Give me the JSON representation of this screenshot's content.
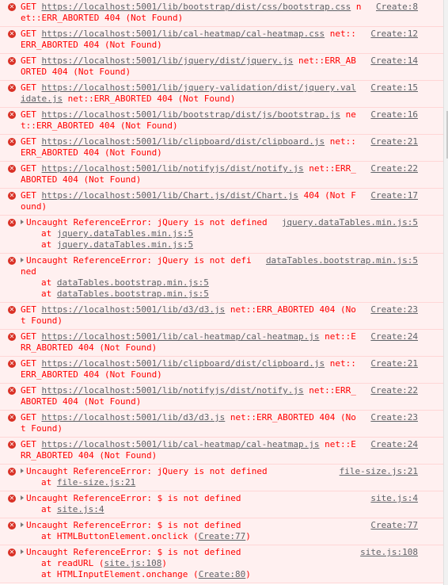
{
  "console": {
    "entries": [
      {
        "type": "get",
        "url": "https://localhost:5001/lib/bootstrap/dist/css/bootstrap.css",
        "suffix": "net::ERR_ABORTED 404 (Not Found)",
        "source": "Create:8"
      },
      {
        "type": "get",
        "url": "https://localhost:5001/lib/cal-heatmap/cal-heatmap.css",
        "suffix": "net::ERR_ABORTED 404 (Not Found)",
        "source": "Create:12"
      },
      {
        "type": "get",
        "url": "https://localhost:5001/lib/jquery/dist/jquery.js",
        "suffix": "net::ERR_ABORTED 404 (Not Found)",
        "source": "Create:14"
      },
      {
        "type": "get",
        "url": "https://localhost:5001/lib/jquery-validation/dist/jquery.validate.js",
        "suffix": "net::ERR_ABORTED 404 (Not Found)",
        "source": "Create:15"
      },
      {
        "type": "get",
        "url": "https://localhost:5001/lib/bootstrap/dist/js/bootstrap.js",
        "suffix": "net::ERR_ABORTED 404 (Not Found)",
        "source": "Create:16"
      },
      {
        "type": "get",
        "url": "https://localhost:5001/lib/clipboard/dist/clipboard.js",
        "suffix": "net::ERR_ABORTED 404 (Not Found)",
        "source": "Create:21"
      },
      {
        "type": "get",
        "url": "https://localhost:5001/lib/notifyjs/dist/notify.js",
        "suffix": "net::ERR_ABORTED 404 (Not Found)",
        "source": "Create:22"
      },
      {
        "type": "get",
        "url": "https://localhost:5001/lib/Chart.js/dist/Chart.js",
        "suffix": "404 (Not Found)",
        "source": "Create:17"
      },
      {
        "type": "ref",
        "message": "Uncaught ReferenceError: jQuery is not defined",
        "source": "jquery.dataTables.min.js:5",
        "stack": [
          {
            "prefix": "at ",
            "link": "jquery.dataTables.min.js:5",
            "suffix": ""
          },
          {
            "prefix": "at ",
            "link": "jquery.dataTables.min.js:5",
            "suffix": ""
          }
        ]
      },
      {
        "type": "ref",
        "message": "Uncaught ReferenceError: jQuery is not defined",
        "source": "dataTables.bootstrap.min.js:5",
        "stack": [
          {
            "prefix": "at ",
            "link": "dataTables.bootstrap.min.js:5",
            "suffix": ""
          },
          {
            "prefix": "at ",
            "link": "dataTables.bootstrap.min.js:5",
            "suffix": ""
          }
        ]
      },
      {
        "type": "get",
        "url": "https://localhost:5001/lib/d3/d3.js",
        "suffix": "net::ERR_ABORTED 404 (Not Found)",
        "source": "Create:23"
      },
      {
        "type": "get",
        "url": "https://localhost:5001/lib/cal-heatmap/cal-heatmap.js",
        "suffix": "net::ERR_ABORTED 404 (Not Found)",
        "source": "Create:24"
      },
      {
        "type": "get",
        "url": "https://localhost:5001/lib/clipboard/dist/clipboard.js",
        "suffix": "net::ERR_ABORTED 404 (Not Found)",
        "source": "Create:21"
      },
      {
        "type": "get",
        "url": "https://localhost:5001/lib/notifyjs/dist/notify.js",
        "suffix": "net::ERR_ABORTED 404 (Not Found)",
        "source": "Create:22"
      },
      {
        "type": "get",
        "url": "https://localhost:5001/lib/d3/d3.js",
        "suffix": "net::ERR_ABORTED 404 (Not Found)",
        "source": "Create:23"
      },
      {
        "type": "get",
        "url": "https://localhost:5001/lib/cal-heatmap/cal-heatmap.js",
        "suffix": "net::ERR_ABORTED 404 (Not Found)",
        "source": "Create:24"
      },
      {
        "type": "ref",
        "message": "Uncaught ReferenceError: jQuery is not defined",
        "source": "file-size.js:21",
        "stack": [
          {
            "prefix": "at ",
            "link": "file-size.js:21",
            "suffix": ""
          }
        ]
      },
      {
        "type": "ref",
        "message": "Uncaught ReferenceError: $ is not defined",
        "source": "site.js:4",
        "stack": [
          {
            "prefix": "at ",
            "link": "site.js:4",
            "suffix": ""
          }
        ]
      },
      {
        "type": "ref",
        "message": "Uncaught ReferenceError: $ is not defined",
        "source": "Create:77",
        "stack": [
          {
            "prefix": "at HTMLButtonElement.onclick (",
            "link": "Create:77",
            "suffix": ")"
          }
        ]
      },
      {
        "type": "ref",
        "message": "Uncaught ReferenceError: $ is not defined",
        "source": "site.js:108",
        "stack": [
          {
            "prefix": "at readURL (",
            "link": "site.js:108",
            "suffix": ")"
          },
          {
            "prefix": "at HTMLInputElement.onchange (",
            "link": "Create:80",
            "suffix": ")"
          }
        ]
      }
    ],
    "get_prefix": "GET ",
    "error_icon": "error-x-icon",
    "colors": {
      "error_bg": "#fff0f0",
      "error_text": "#ff0000",
      "link": "#5f6368",
      "icon": "#d93025"
    }
  }
}
